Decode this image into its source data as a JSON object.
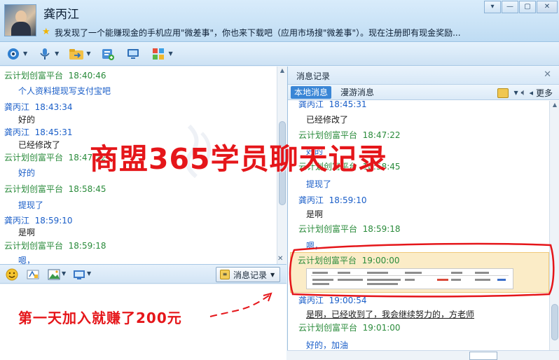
{
  "title_bar": {
    "user_name": "龚丙江",
    "signature": "我发现了一个能赚现金的手机应用\"微差事\"，你也来下载吧（应用市场搜\"微差事\"）。现在注册即有现金奖励...",
    "icons": [
      "avatar",
      "star-icon",
      "minimize-icon",
      "maximize-icon",
      "close-icon"
    ]
  },
  "toolbar": {
    "icons": [
      "video-icon",
      "microphone-icon",
      "file-transfer-icon",
      "add-contact-icon",
      "screen-share-icon",
      "apps-icon"
    ]
  },
  "chat": {
    "messages": [
      {
        "sender": "云计划创富平台",
        "time": "18:40:46",
        "text": "个人资料提现写支付宝吧",
        "role": "platform",
        "text_color": "blue"
      },
      {
        "sender": "龚丙江",
        "time": "18:43:34",
        "text": "好的",
        "role": "me",
        "text_color": "black"
      },
      {
        "sender": "龚丙江",
        "time": "18:45:31",
        "text": "已经修改了",
        "role": "me",
        "text_color": "black"
      },
      {
        "sender": "云计划创富平台",
        "time": "18:47:22",
        "text": "好的",
        "role": "platform",
        "text_color": "blue"
      },
      {
        "sender": "云计划创富平台",
        "time": "18:58:45",
        "text": "提现了",
        "role": "platform",
        "text_color": "blue"
      },
      {
        "sender": "龚丙江",
        "time": "18:59:10",
        "text": "是啊",
        "role": "me",
        "text_color": "black"
      },
      {
        "sender": "云计划创富平台",
        "time": "18:59:18",
        "text": "嗯，",
        "role": "platform",
        "text_color": "blue"
      }
    ]
  },
  "input_toolbar": {
    "history_button_label": "消息记录",
    "icons": [
      "emoji-icon",
      "font-icon",
      "image-icon",
      "screenshot-icon"
    ]
  },
  "history_panel": {
    "title": "消息记录",
    "tabs": [
      "本地消息",
      "漫游消息"
    ],
    "more_label": "更多",
    "messages": [
      {
        "sender": "龚丙江",
        "time": "18:45:31",
        "text": "已经修改了",
        "role": "me",
        "text_color": "black"
      },
      {
        "sender": "云计划创富平台",
        "time": "18:47:22",
        "text": "好的",
        "role": "platform",
        "text_color": "blue"
      },
      {
        "sender": "云计划创富平台",
        "time": "18:58:45",
        "text": "提现了",
        "role": "platform",
        "text_color": "blue"
      },
      {
        "sender": "龚丙江",
        "time": "18:59:10",
        "text": "是啊",
        "role": "me",
        "text_color": "black"
      },
      {
        "sender": "云计划创富平台",
        "time": "18:59:18",
        "text": "嗯，",
        "role": "platform",
        "text_color": "blue"
      },
      {
        "sender": "云计划创富平台",
        "time": "19:00:00",
        "text": "",
        "role": "platform",
        "text_color": "blue"
      },
      {
        "sender": "龚丙江",
        "time": "19:00:54",
        "text": "是啊，已经收到了，我会继续努力的，方老师",
        "role": "me",
        "text_color": "black"
      },
      {
        "sender": "云计划创富平台",
        "time": "19:01:00",
        "text": "好的，加油",
        "role": "platform",
        "text_color": "blue"
      }
    ]
  },
  "annotations": {
    "headline": "商盟365学员聊天记录",
    "caption": "第一天加入就赚了200元"
  },
  "colors": {
    "platform_name": "#2a8b3b",
    "user_name": "#1a5ec8",
    "annotation_red": "#e5161a",
    "highlight_bg": "#fbecc7"
  }
}
